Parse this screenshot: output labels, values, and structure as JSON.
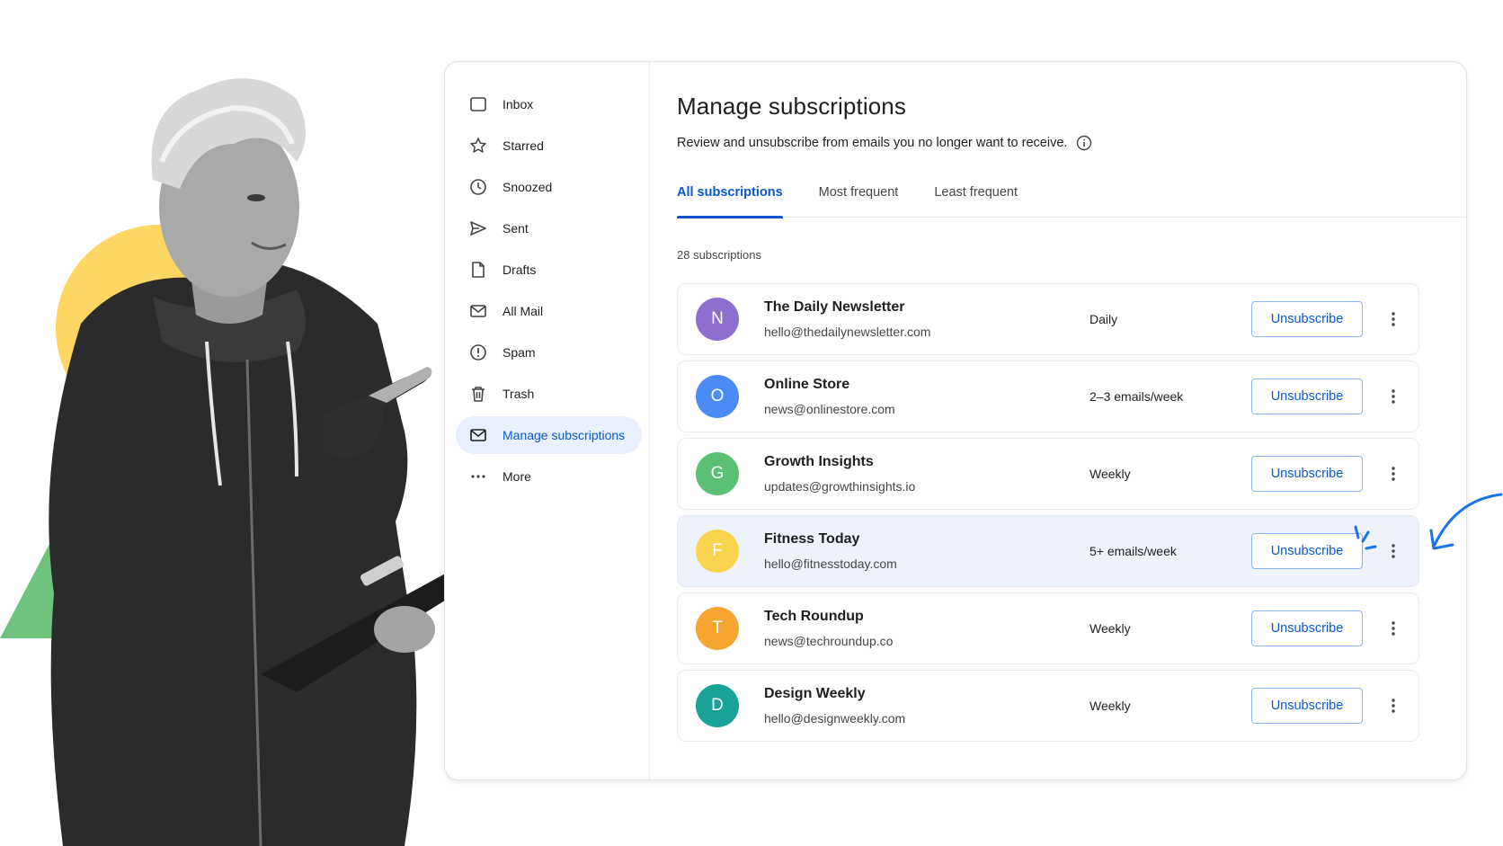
{
  "colors": {
    "accent": "#0b57d0",
    "active_nav_bg": "#e8f0fe",
    "deco_yellow": "#fdd663",
    "deco_green": "#6fc37c",
    "annotation_blue": "#1a73e8"
  },
  "sidebar": {
    "items": [
      {
        "label": "Inbox",
        "icon": "inbox-icon"
      },
      {
        "label": "Starred",
        "icon": "star-icon"
      },
      {
        "label": "Snoozed",
        "icon": "clock-icon"
      },
      {
        "label": "Sent",
        "icon": "send-icon"
      },
      {
        "label": "Drafts",
        "icon": "draft-icon"
      },
      {
        "label": "All Mail",
        "icon": "mail-icon"
      },
      {
        "label": "Spam",
        "icon": "spam-icon"
      },
      {
        "label": "Trash",
        "icon": "trash-icon"
      },
      {
        "label": "Manage subscriptions",
        "icon": "mail-icon",
        "active": true
      },
      {
        "label": "More",
        "icon": "more-horizontal-icon"
      }
    ]
  },
  "main": {
    "title": "Manage subscriptions",
    "subtitle": "Review and unsubscribe from emails you no longer want to receive.",
    "tabs": [
      {
        "label": "All subscriptions",
        "active": true
      },
      {
        "label": "Most frequent"
      },
      {
        "label": "Least frequent"
      }
    ],
    "count_text": "28 subscriptions",
    "unsubscribe_label": "Unsubscribe",
    "subscriptions": [
      {
        "initial": "N",
        "name": "The Daily Newsletter",
        "email": "hello@thedailynewsletter.com",
        "frequency": "Daily",
        "color": "#8e6fd0"
      },
      {
        "initial": "O",
        "name": "Online Store",
        "email": "news@onlinestore.com",
        "frequency": "2–3 emails/week",
        "color": "#4c8bf5"
      },
      {
        "initial": "G",
        "name": "Growth Insights",
        "email": "updates@growthinsights.io",
        "frequency": "Weekly",
        "color": "#5bbf74"
      },
      {
        "initial": "F",
        "name": "Fitness Today",
        "email": "hello@fitnesstoday.com",
        "frequency": "5+ emails/week",
        "color": "#fbd44f",
        "highlight": true
      },
      {
        "initial": "T",
        "name": "Tech Roundup",
        "email": "news@techroundup.co",
        "frequency": "Weekly",
        "color": "#f6a531"
      },
      {
        "initial": "D",
        "name": "Design Weekly",
        "email": "hello@designweekly.com",
        "frequency": "Weekly",
        "color": "#17a398"
      }
    ]
  }
}
